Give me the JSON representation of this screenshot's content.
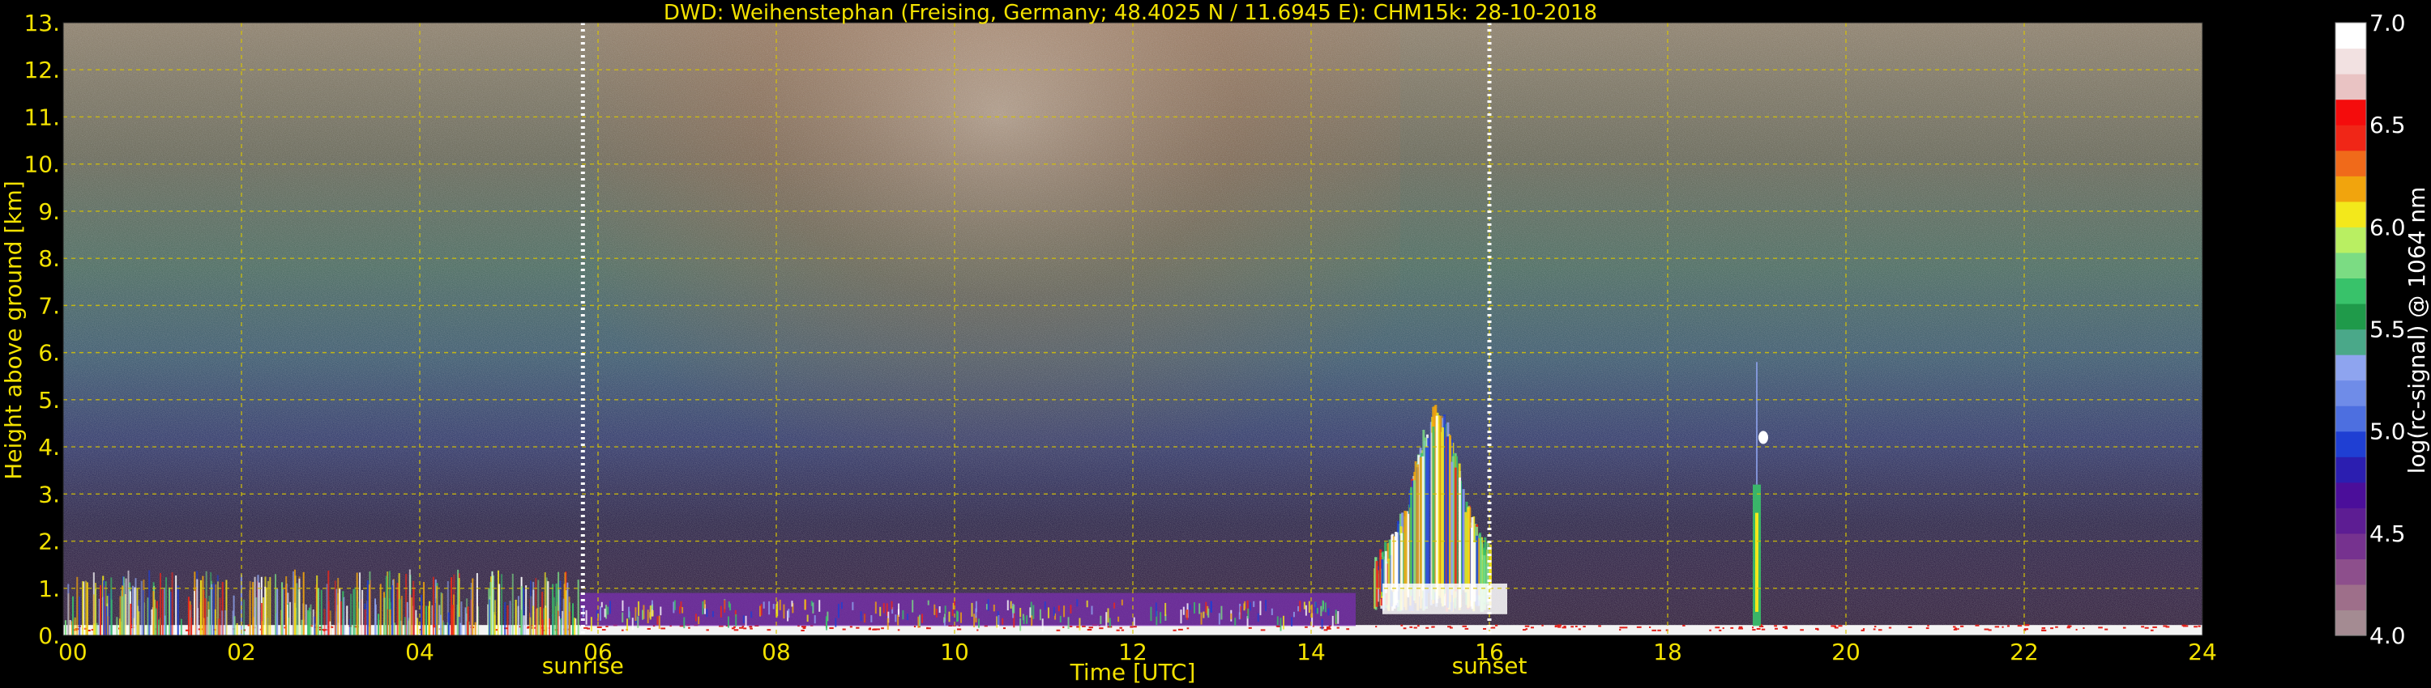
{
  "chart_data": {
    "type": "heatmap",
    "title": "DWD: Weihenstephan (Freising, Germany; 48.4025 N / 11.6945 E):    CHM15k: 28-10-2018",
    "xlabel": "Time [UTC]",
    "ylabel": "Height above ground [km]",
    "xlim": [
      0,
      24
    ],
    "ylim": [
      0,
      13
    ],
    "x_ticks": [
      "00",
      "02",
      "04",
      "06",
      "08",
      "10",
      "12",
      "14",
      "16",
      "18",
      "20",
      "22",
      "24"
    ],
    "y_ticks": [
      "0.",
      "1.",
      "2.",
      "3.",
      "4.",
      "5.",
      "6.",
      "7.",
      "8.",
      "9.",
      "10.",
      "11.",
      "12.",
      "13."
    ],
    "grid": true,
    "markers": [
      {
        "label": "sunrise",
        "x": 5.83
      },
      {
        "label": "sunset",
        "x": 16.0
      }
    ],
    "colorbar": {
      "label": "log(rc-signal) @ 1064 nm",
      "range": [
        4.0,
        7.0
      ],
      "ticks": [
        "4.0",
        "4.5",
        "5.0",
        "5.5",
        "6.0",
        "6.5",
        "7.0"
      ],
      "colors": [
        "#a48b92",
        "#9e6f8a",
        "#8d4f8c",
        "#76328f",
        "#5d1d93",
        "#4b0e9a",
        "#2b1eb0",
        "#1f3fd3",
        "#4d6fe0",
        "#6f8ce8",
        "#8ea4ef",
        "#4aa889",
        "#1f9a4a",
        "#38c26a",
        "#7bdc83",
        "#b9ef62",
        "#f3e81b",
        "#f1a40d",
        "#f06a1a",
        "#f02617",
        "#f40c0c",
        "#e9c3c3",
        "#f2e1e1",
        "#ffffff"
      ]
    },
    "regions": [
      {
        "feature": "nocturnal boundary layer",
        "x": [
          0,
          5.8
        ],
        "height_km": [
          0,
          1.4
        ]
      },
      {
        "feature": "residual layer",
        "x": [
          5.8,
          14.5
        ],
        "height_km": [
          0.2,
          0.9
        ]
      },
      {
        "feature": "cloud layer",
        "x": [
          14.7,
          16.0
        ],
        "height_km": [
          0.5,
          4.3
        ]
      },
      {
        "feature": "isolated cloud",
        "x": [
          18.9,
          19.1
        ],
        "height_km": [
          0.2,
          5.8
        ]
      }
    ]
  },
  "colors": {
    "axis_text": "#f2e100",
    "grid": "#d8c400",
    "background": "#000000"
  }
}
